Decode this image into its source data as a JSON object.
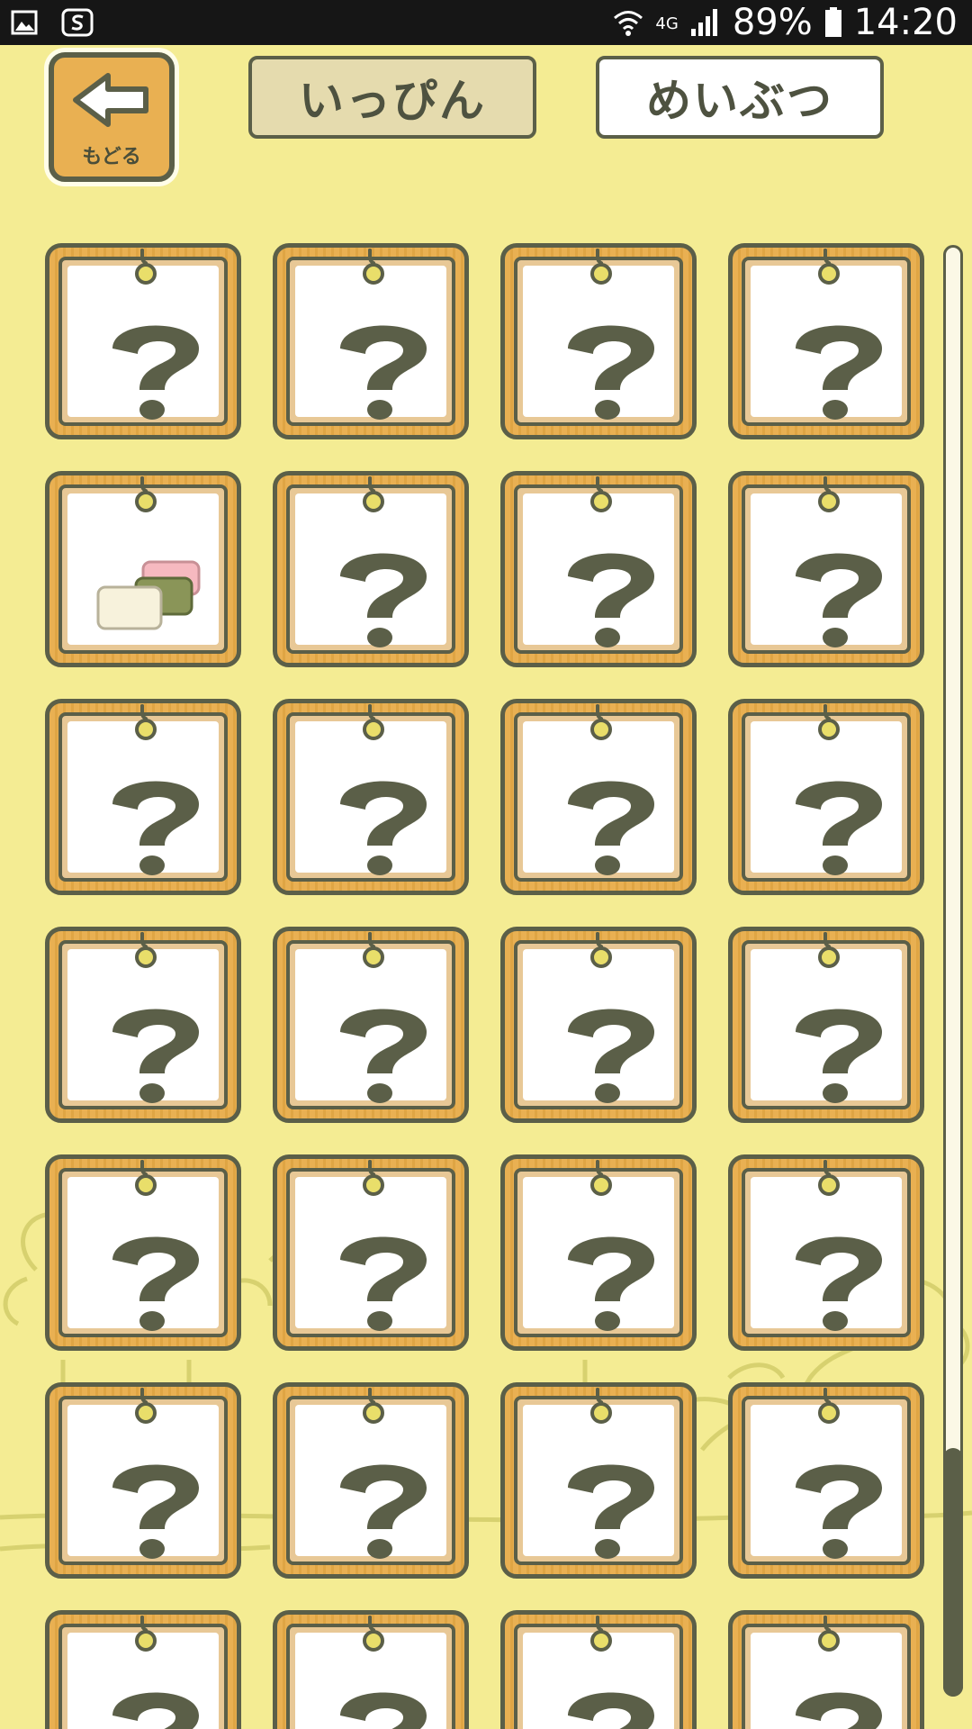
{
  "status_bar": {
    "network_type": "4G",
    "battery_percent": "89%",
    "time": "14:20",
    "icons": [
      "gallery-icon",
      "app-icon",
      "wifi-icon",
      "signal-icon",
      "battery-icon"
    ]
  },
  "header": {
    "back_label": "もどる",
    "tabs": [
      {
        "label": "いっぴん",
        "selected": true
      },
      {
        "label": "めいぶつ",
        "selected": false
      }
    ]
  },
  "grid": {
    "columns": 4,
    "rows_visible": 7,
    "locked_icon": "question-mark-icon",
    "unlocked_items": [
      {
        "row": 2,
        "column": 1,
        "icon": "rice-cake-icon"
      }
    ]
  },
  "scrollbar": {
    "position": "bottom"
  },
  "colors": {
    "background": "#f4ec93",
    "frame_wood": "#e9b052",
    "outline": "#5b5f48",
    "selected_tab": "#e5dbae",
    "unselected_tab": "#ffffff"
  }
}
